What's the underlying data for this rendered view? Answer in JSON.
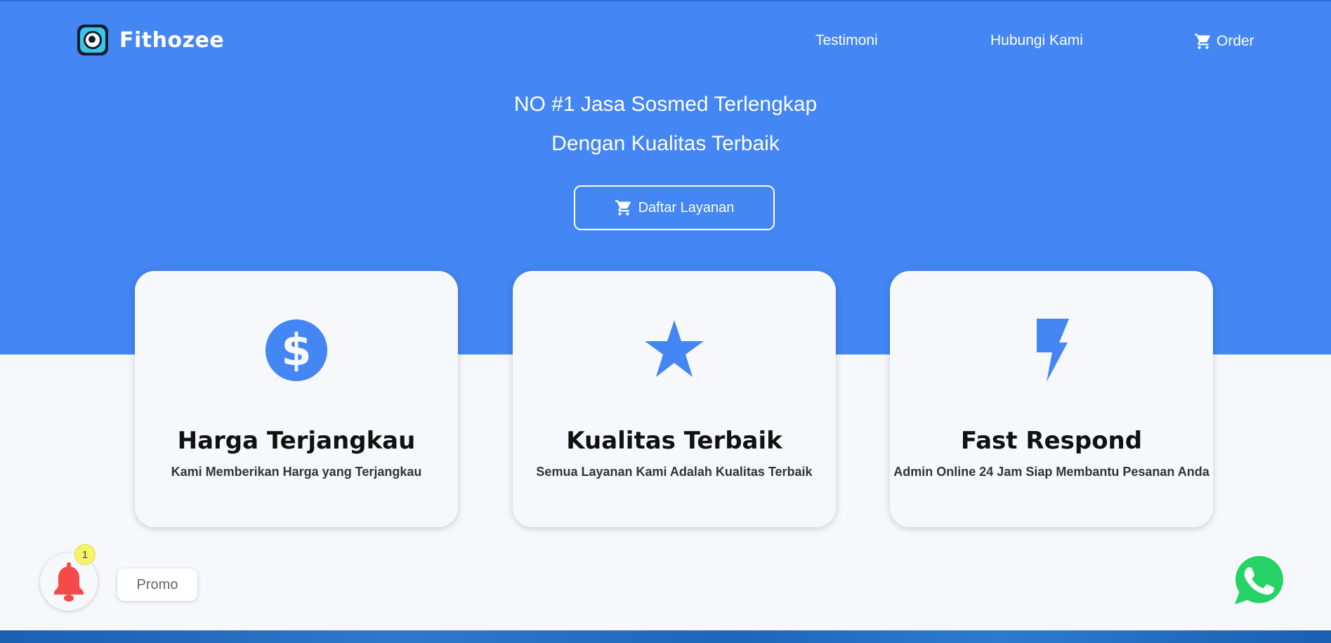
{
  "brand": {
    "name": "Fithozee"
  },
  "nav": {
    "items": [
      {
        "label": "Testimoni"
      },
      {
        "label": "Hubungi Kami"
      },
      {
        "label": "Order"
      }
    ]
  },
  "hero": {
    "headline_1": "NO #1 Jasa Sosmed Terlengkap",
    "headline_2": "Dengan Kualitas Terbaik",
    "cta_label": "Daftar Layanan"
  },
  "features": [
    {
      "icon": "dollar-icon",
      "title": "Harga Terjangkau",
      "desc": "Kami Memberikan Harga yang Terjangkau"
    },
    {
      "icon": "star-icon",
      "title": "Kualitas Terbaik",
      "desc": "Semua Layanan Kami Adalah Kualitas Terbaik"
    },
    {
      "icon": "lightning-icon",
      "title": "Fast Respond",
      "desc": "Admin Online 24 Jam Siap Membantu Pesanan Anda"
    }
  ],
  "widgets": {
    "notification_count": "1",
    "promo_label": "Promo"
  },
  "colors": {
    "primary": "#4386f4",
    "background": "#f6f8fc",
    "bell": "#f44a4a",
    "badge": "#f5f36a",
    "whatsapp": "#25d366"
  }
}
